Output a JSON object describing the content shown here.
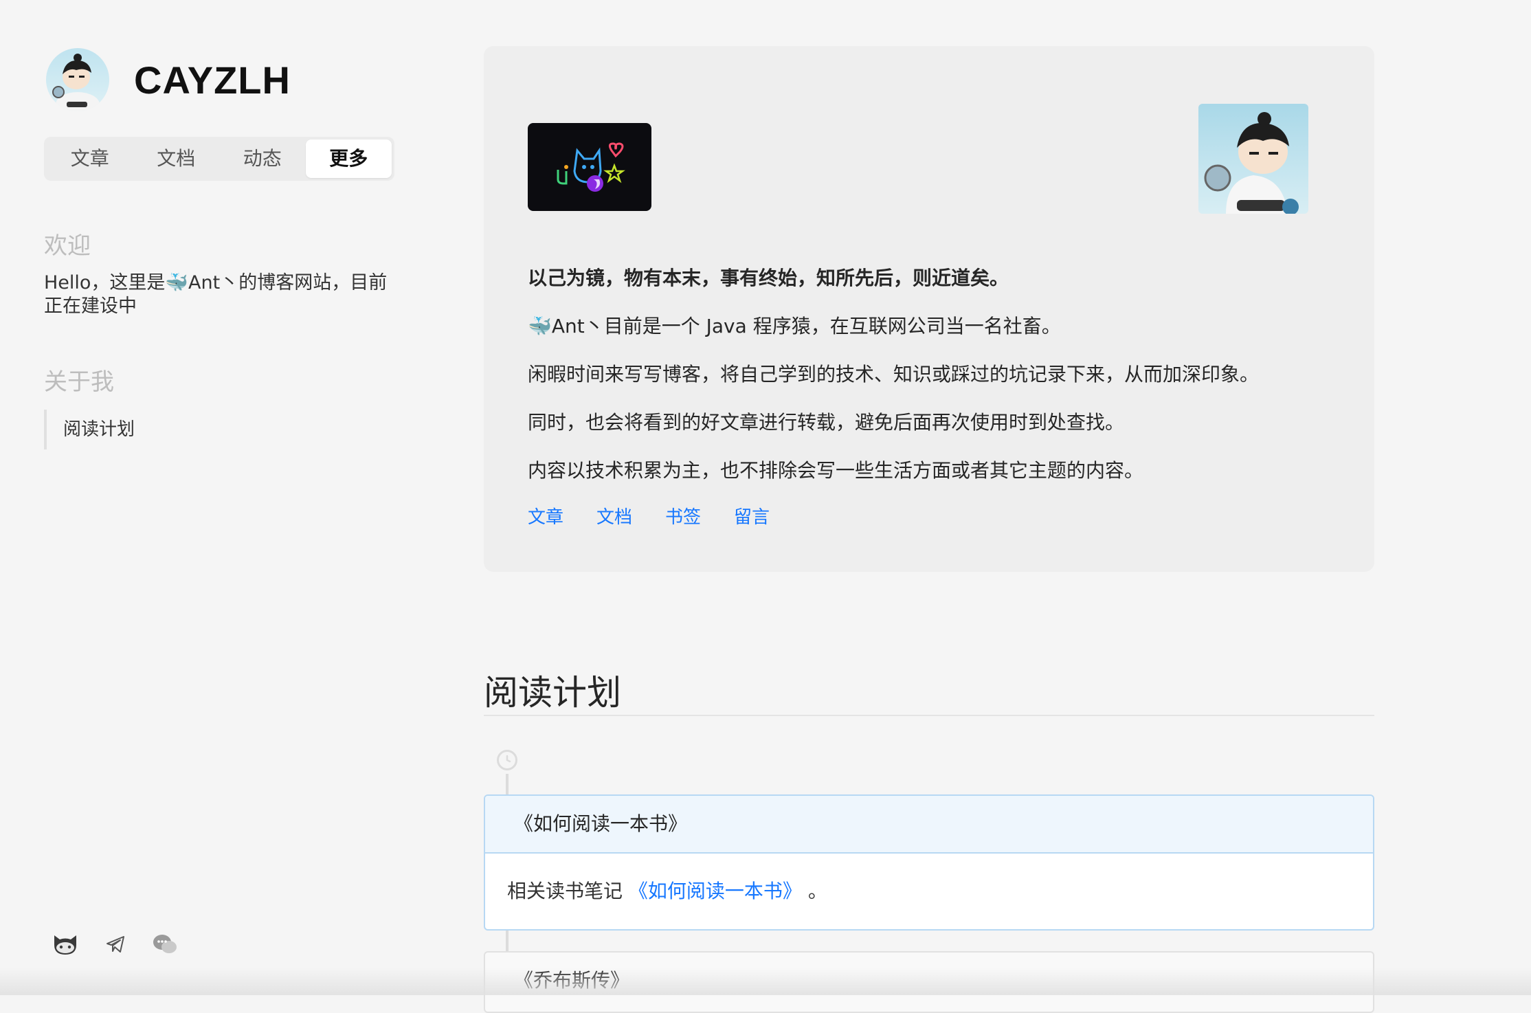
{
  "site": {
    "name": "CAYZLH"
  },
  "nav": {
    "tabs": [
      {
        "label": "文章"
      },
      {
        "label": "文档"
      },
      {
        "label": "动态"
      },
      {
        "label": "更多"
      }
    ],
    "active_tab": "更多"
  },
  "sidebar": {
    "welcome_title": "欢迎",
    "welcome_text": "Hello，这里是🐳Ant丶的博客网站，目前正在建设中",
    "about_title": "关于我",
    "about_link": "阅读计划",
    "social_icons": [
      "github-icon",
      "telegram-icon",
      "wechat-icon"
    ]
  },
  "intro": {
    "motto": "以己为镜，物有本末，事有终始，知所先后，则近道矣。",
    "lines": [
      "🐳Ant丶目前是一个 Java 程序猿，在互联网公司当一名社畜。",
      "闲暇时间来写写博客，将自己学到的技术、知识或踩过的坑记录下来，从而加深印象。",
      "同时，也会将看到的好文章进行转载，避免后面再次使用时到处查找。",
      "内容以技术积累为主，也不排除会写一些生活方面或者其它主题的内容。"
    ],
    "links": [
      {
        "label": "文章"
      },
      {
        "label": "文档"
      },
      {
        "label": "书签"
      },
      {
        "label": "留言"
      }
    ]
  },
  "reading_plan": {
    "title": "阅读计划",
    "books": [
      {
        "title": "《如何阅读一本书》",
        "body_prefix": "相关读书笔记",
        "body_link": "《如何阅读一本书》",
        "body_suffix": "。"
      },
      {
        "title": "《乔布斯传》"
      }
    ]
  },
  "colors": {
    "accent": "#1677ff",
    "card_border": "#b7d8f3",
    "card_head_bg": "#eef6fd",
    "page_bg": "#f5f5f5"
  }
}
